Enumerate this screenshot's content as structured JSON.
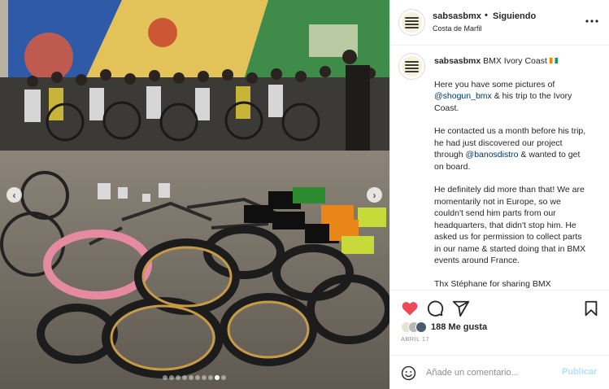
{
  "post": {
    "username": "sabsasbmx",
    "separator": "•",
    "follow_status": "Siguiendo",
    "location": "Costa de Marfil",
    "more_label": "•••"
  },
  "photo": {
    "slide_count": 10,
    "active_slide": 9
  },
  "caption": {
    "username": "sabsasbmx",
    "title": "BMX Ivory Coast",
    "p1_a": "Here you have some pictures of ",
    "p1_link": "@shogun_bmx",
    "p1_b": " & his trip to the Ivory Coast.",
    "p2_a": "He contacted us a month before his trip, he had just discovered our project through ",
    "p2_link": "@banosdistro",
    "p2_b": " & wanted to get on board.",
    "p3": "He definitely did more than that! We are momentarily not in Europe, so we couldn't send him parts from our headquarters, that didn't stop him. He asked us for permission to collect parts in our name & started doing that in BMX events around France.",
    "p4": "Thx Stéphane for sharing BMX"
  },
  "stats": {
    "likes_text": "188 Me gusta",
    "date": "ABRIL 17"
  },
  "comment": {
    "placeholder": "Añade un comentario...",
    "publish_label": "Publicar"
  },
  "colors": {
    "like_red": "#ed4956",
    "link_blue": "#00376b",
    "publish_disabled": "#b2dffc"
  }
}
